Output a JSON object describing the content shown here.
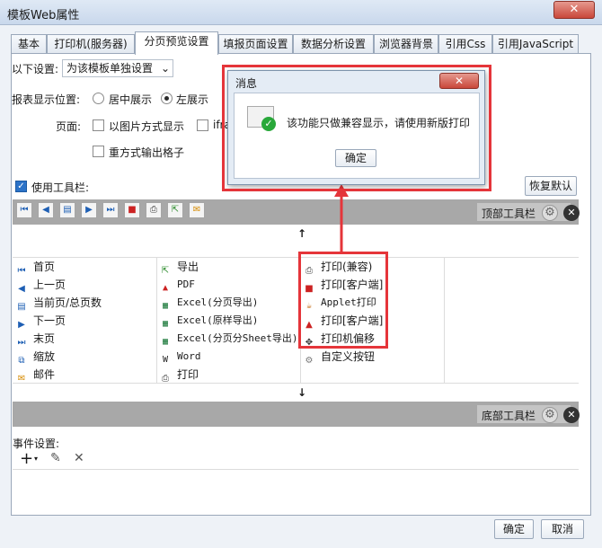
{
  "window": {
    "title": "模板Web属性",
    "close_glyph": "✕"
  },
  "tabs": [
    {
      "label": "基本"
    },
    {
      "label": "打印机(服务器)"
    },
    {
      "label": "分页预览设置"
    },
    {
      "label": "填报页面设置"
    },
    {
      "label": "数据分析设置"
    },
    {
      "label": "浏览器背景"
    },
    {
      "label": "引用Css"
    },
    {
      "label": "引用JavaScript"
    }
  ],
  "settings": {
    "scope_label": "以下设置:",
    "scope_value": "为该模板单独设置",
    "position_label": "报表显示位置:",
    "center_label": "居中展示",
    "left_label": "左展示",
    "page_label": "页面:",
    "image_mode_label": "以图片方式显示",
    "iframe_label": "iframe",
    "repeat_grid_label": "重方式输出格子",
    "use_toolbar_label": "使用工具栏:",
    "restore_default": "恢复默认"
  },
  "toolbar_top": {
    "label": "顶部工具栏",
    "arrow_up": "↑",
    "arrow_down": "↓"
  },
  "toolbar_bottom": {
    "label": "底部工具栏"
  },
  "items_col1": [
    {
      "icon": "first-page-icon",
      "label": "首页"
    },
    {
      "icon": "prev-page-icon",
      "label": "上一页"
    },
    {
      "icon": "page-count-icon",
      "label": "当前页/总页数"
    },
    {
      "icon": "next-page-icon",
      "label": "下一页"
    },
    {
      "icon": "last-page-icon",
      "label": "末页"
    },
    {
      "icon": "zoom-icon",
      "label": "缩放"
    },
    {
      "icon": "mail-icon",
      "label": "邮件"
    }
  ],
  "items_col2": [
    {
      "icon": "export-icon",
      "label": "导出"
    },
    {
      "icon": "pdf-icon",
      "label": "PDF"
    },
    {
      "icon": "excel-icon",
      "label": "Excel(分页导出)"
    },
    {
      "icon": "excel-icon",
      "label": "Excel(原样导出)"
    },
    {
      "icon": "excel-icon",
      "label": "Excel(分页分Sheet导出)"
    },
    {
      "icon": "word-icon",
      "label": "Word"
    },
    {
      "icon": "print-icon",
      "label": "打印"
    }
  ],
  "items_col3": [
    {
      "icon": "print-icon",
      "label": "打印(兼容)"
    },
    {
      "icon": "flash-print-icon",
      "label": "打印[客户端]"
    },
    {
      "icon": "applet-icon",
      "label": "Applet打印"
    },
    {
      "icon": "pdf-print-icon",
      "label": "打印[客户端]"
    },
    {
      "icon": "offset-icon",
      "label": "打印机偏移"
    },
    {
      "icon": "custom-button-icon",
      "label": "自定义按钮"
    }
  ],
  "events": {
    "label": "事件设置:"
  },
  "footer": {
    "ok": "确定",
    "cancel": "取消"
  },
  "message_dialog": {
    "title": "消息",
    "text": "该功能只做兼容显示，请使用新版打印",
    "ok": "确定",
    "close_glyph": "✕"
  },
  "colors": {
    "highlight": "#e5353a",
    "accent": "#2c73c8"
  }
}
